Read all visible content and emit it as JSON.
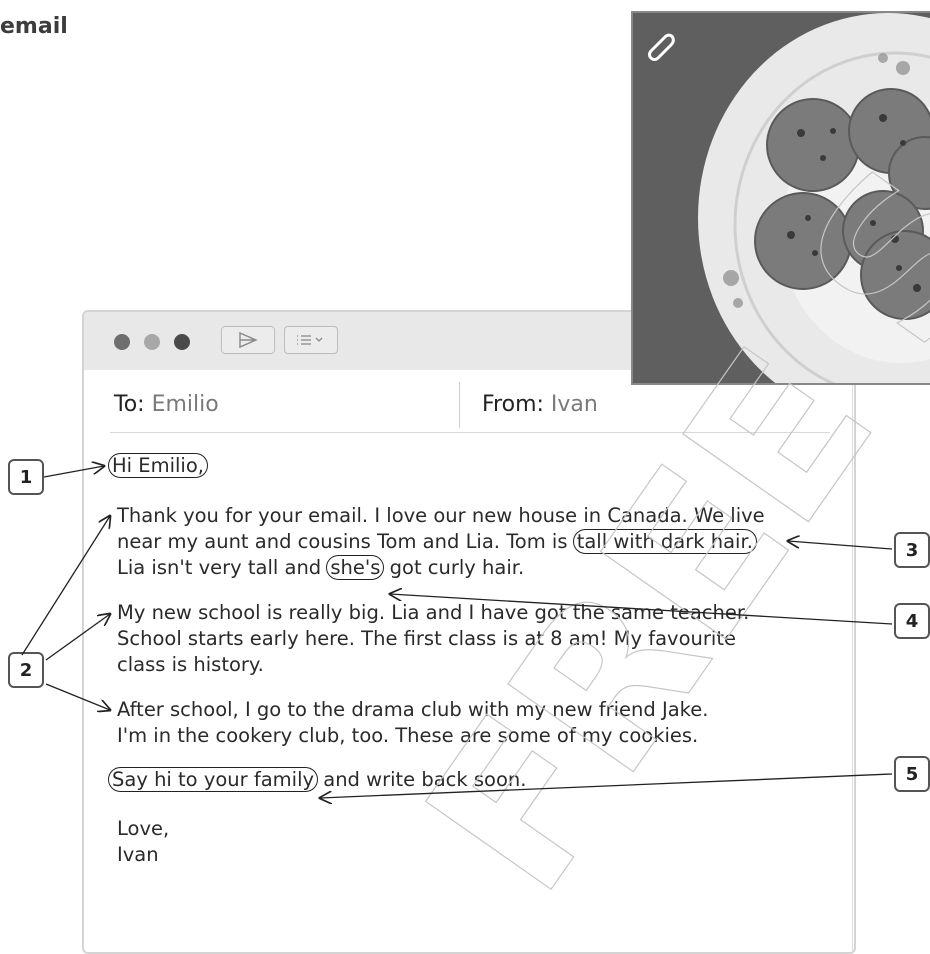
{
  "page_title": "email",
  "email": {
    "to_label": "To:",
    "to_value": "Emilio",
    "from_label": "From:",
    "from_value": "Ivan",
    "greeting": "Hi Emilio,",
    "p1_line1": "Thank you for your email. I love our new house in Canada. We live",
    "p1_line2_pre": "near my aunt and cousins Tom and Lia. Tom is ",
    "p1_line2_circled": "tall with dark hair.",
    "p1_line3_pre": "Lia isn't very tall and ",
    "p1_line3_circled": "she's",
    "p1_line3_post": " got curly hair.",
    "p2_line1": "My new school is really big. Lia and I have got the same teacher.",
    "p2_line2": "School starts early here. The first class is at 8 am! My favourite",
    "p2_line3": "class is history.",
    "p3_line1": "After school, I go to the drama club with my new friend Jake.",
    "p3_line2": "I'm in the cookery club, too. These are some of my cookies.",
    "p4_circled": "Say hi to your family",
    "p4_post": " and write back soon.",
    "signoff": "Love,",
    "signature": "Ivan"
  },
  "annotations": [
    "1",
    "2",
    "3",
    "4",
    "5"
  ],
  "attachment": {
    "icon": "paperclip-icon",
    "image": "cookies-on-plate"
  },
  "watermark": "FREE SAMPLE",
  "colors": {
    "toolbar": "#e8e8e8",
    "window_border": "#d4d4d4",
    "header_value": "#7a7a7a"
  }
}
